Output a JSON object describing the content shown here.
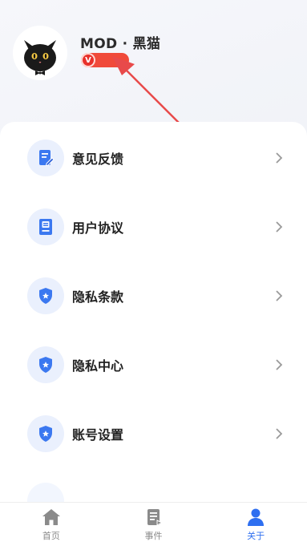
{
  "profile": {
    "avatar_icon": "black-cat-avatar-icon",
    "username": "MOD · 黑猫",
    "vip_badge_letter": "V"
  },
  "menu": {
    "items": [
      {
        "label": "意见反馈",
        "icon": "feedback-icon"
      },
      {
        "label": "用户协议",
        "icon": "agreement-icon"
      },
      {
        "label": "隐私条款",
        "icon": "shield-star-icon"
      },
      {
        "label": "隐私中心",
        "icon": "shield-star-icon"
      },
      {
        "label": "账号设置",
        "icon": "shield-star-icon"
      }
    ]
  },
  "tabbar": {
    "tabs": [
      {
        "label": "首页",
        "icon": "home-icon",
        "active": false
      },
      {
        "label": "事件",
        "icon": "event-icon",
        "active": false
      },
      {
        "label": "关于",
        "icon": "user-icon",
        "active": true
      }
    ]
  },
  "colors": {
    "accent": "#2e6ff0",
    "icon_bg": "#eaf0fd",
    "badge_red": "#f04a3a",
    "annotation_arrow": "#e84a4a"
  }
}
